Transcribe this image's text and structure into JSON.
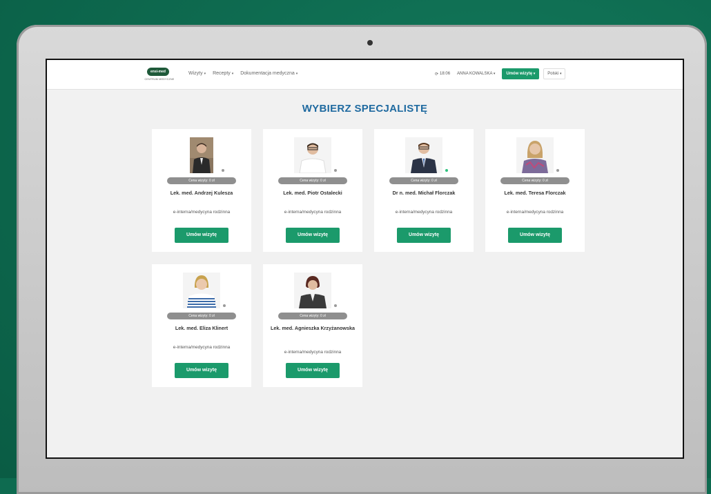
{
  "nav": {
    "logo_text": "ensi-med",
    "logo_sub": "CENTRUM MEDYCZNE",
    "menu": [
      {
        "label": "Wizyty"
      },
      {
        "label": "Recepty"
      },
      {
        "label": "Dokumentacja medyczna"
      }
    ],
    "time": "18:06",
    "user": "ANNA KOWALSKA",
    "book_button": "Umów wizytę",
    "language": "Polski"
  },
  "main": {
    "title": "WYBIERZ SPECJALISTĘ",
    "doctors": [
      {
        "name": "Lek. med. Andrzej Kulesza",
        "price": "Cena wizyty: 0 zł",
        "specialty": "e-interna/medycyna rodzinna",
        "button": "Umów wizytę",
        "status": "offline"
      },
      {
        "name": "Lek. med. Piotr Ostalecki",
        "price": "Cena wizyty: 0 zł",
        "specialty": "e-interna/medycyna rodzinna",
        "button": "Umów wizytę",
        "status": "offline"
      },
      {
        "name": "Dr n. med. Michał Florczak",
        "price": "Cena wizyty: 0 zł",
        "specialty": "e-interna/medycyna rodzinna",
        "button": "Umów wizytę",
        "status": "online"
      },
      {
        "name": "Lek. med. Teresa Florczak",
        "price": "Cena wizyty: 0 zł",
        "specialty": "e-interna/medycyna rodzinna",
        "button": "Umów wizytę",
        "status": "offline"
      },
      {
        "name": "Lek. med. Eliza Klinert",
        "price": "Cena wizyty: 0 zł",
        "specialty": "e-interna/medycyna rodzinna",
        "button": "Umów wizytę",
        "status": "offline"
      },
      {
        "name": "Lek. med. Agnieszka Krzyżanowska",
        "price": "Cena wizyty: 0 zł",
        "specialty": "e-interna/medycyna rodzinna",
        "button": "Umów wizytę",
        "status": "offline"
      }
    ]
  },
  "colors": {
    "accent": "#1b9a6b",
    "title": "#1f6aa0",
    "background": "#0e6b50",
    "online": "#2ec27e",
    "offline": "#9a9a9a"
  }
}
